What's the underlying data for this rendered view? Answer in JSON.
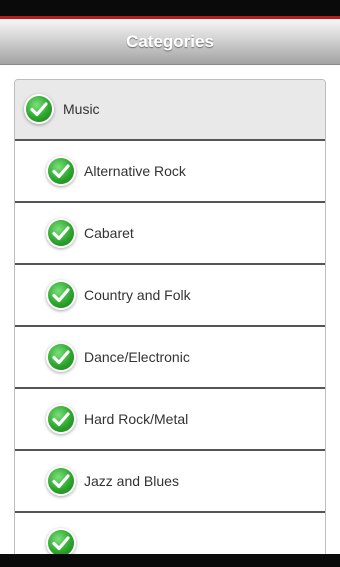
{
  "header": {
    "title": "Categories"
  },
  "icons": {
    "check": "check-circle-icon",
    "check_color": "#2da62d"
  },
  "categories": {
    "parent": {
      "label": "Music"
    },
    "items": [
      {
        "label": "Alternative Rock"
      },
      {
        "label": "Cabaret"
      },
      {
        "label": "Country and Folk"
      },
      {
        "label": "Dance/Electronic"
      },
      {
        "label": "Hard Rock/Metal"
      },
      {
        "label": "Jazz and Blues"
      }
    ]
  }
}
